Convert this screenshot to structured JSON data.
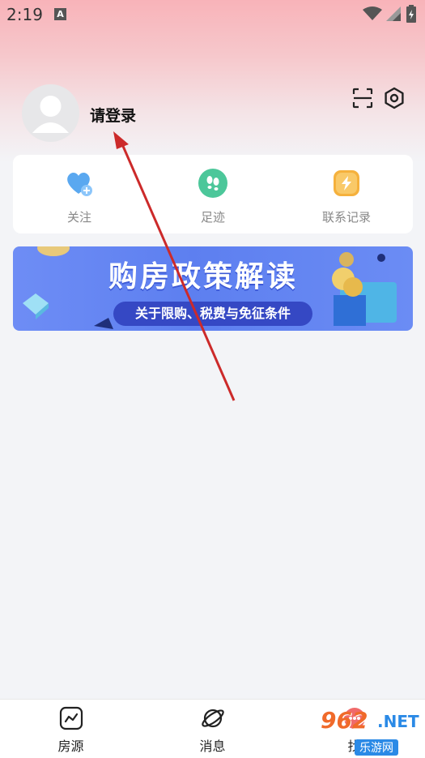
{
  "status_bar": {
    "time": "2:19",
    "badge": "A"
  },
  "profile": {
    "login_label": "请登录"
  },
  "quick_actions": [
    {
      "label": "关注",
      "icon": "heart-plus-icon",
      "color": "#5aa8f0"
    },
    {
      "label": "足迹",
      "icon": "footprint-icon",
      "color": "#4cc79a"
    },
    {
      "label": "联系记录",
      "icon": "lightning-icon",
      "color": "#f5b13d"
    }
  ],
  "banner": {
    "title": "购房政策解读",
    "subtitle": "关于限购、税费与免征条件"
  },
  "bottom_nav": [
    {
      "label": "房源",
      "icon": "trend-chart-icon"
    },
    {
      "label": "消息",
      "icon": "planet-icon"
    },
    {
      "label": "找",
      "icon": "chat-icon"
    }
  ],
  "watermark": {
    "brand": "962",
    "suffix": ".NET",
    "caption": "乐游网"
  },
  "colors": {
    "accent_red": "#cc2a2a",
    "header_pink": "#f8b3b9"
  }
}
